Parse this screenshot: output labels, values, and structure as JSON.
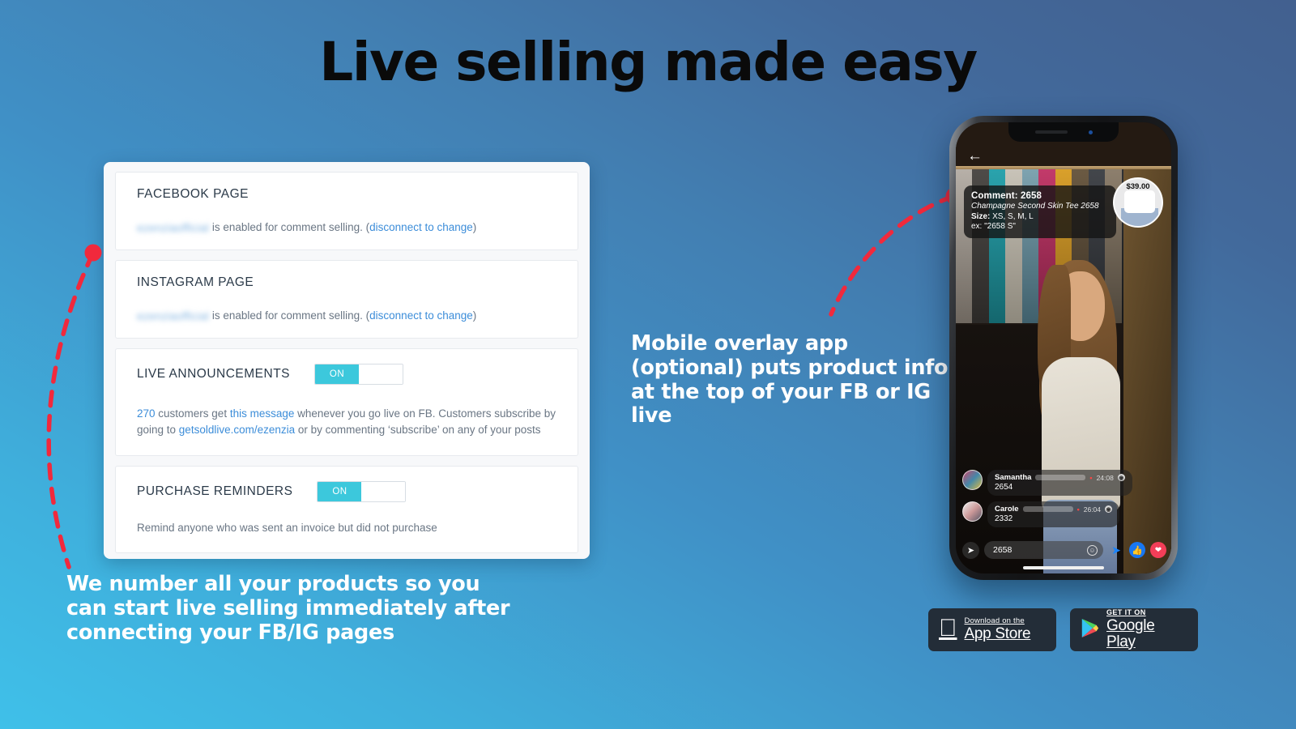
{
  "headline": "Live selling made easy",
  "settings_card": {
    "panels": [
      {
        "title": "FACEBOOK PAGE",
        "redacted_account": "ezenziaofficial",
        "desc_before": " is enabled for comment selling. (",
        "link": "disconnect to change",
        "desc_after": ")"
      },
      {
        "title": "INSTAGRAM PAGE",
        "redacted_account": "ezenziaofficial",
        "desc_before": " is enabled for comment selling. (",
        "link": "disconnect to change",
        "desc_after": ")"
      },
      {
        "title": "LIVE ANNOUNCEMENTS",
        "toggle_label": "ON",
        "toggle_state": "on",
        "count": "270",
        "t1": " customers get ",
        "link1": "this message",
        "t2": " whenever you go live on FB. Customers subscribe by going to ",
        "link2": "getsoldlive.com/ezenzia",
        "t3": " or by commenting ‘subscribe’ on any of your posts"
      },
      {
        "title": "PURCHASE REMINDERS",
        "toggle_label": "ON",
        "toggle_state": "on",
        "desc": "Remind anyone who was sent an invoice but did not purchase"
      }
    ]
  },
  "callouts": {
    "left": "We number all your products so you can start live selling immediately after connecting your FB/IG pages",
    "right": "Mobile overlay app (optional) puts product info at the top of your FB or IG live"
  },
  "phone": {
    "back_arrow": "←",
    "overlay": {
      "comment_label": "Comment: 2658",
      "product_name": "Champagne Second Skin Tee 2658",
      "size_label": "Size:",
      "size_values": " XS, S, M, L",
      "example": "ex: \"2658 S\""
    },
    "price_bubble": "$39.00",
    "comments": [
      {
        "name": "Samantha",
        "time": "24:08",
        "text": "2654"
      },
      {
        "name": "Carole",
        "time": "26:04",
        "text": "2332"
      }
    ],
    "comment_bar": {
      "value": "2658",
      "share_icon": "➤",
      "emoji_icon": "☺",
      "send_icon": "➤",
      "like_icon": "👍",
      "heart_icon": "❤"
    }
  },
  "badges": [
    {
      "top": "Download on the",
      "bottom": "App Store",
      "icon": "apple-icon"
    },
    {
      "top": "GET IT ON",
      "bottom": "Google Play",
      "icon": "google-play-icon"
    }
  ],
  "colors": {
    "accent_cyan": "#3CC8DC",
    "link_blue": "#3C8DD9",
    "marker_red": "#F1293C",
    "badge_dark": "#232D38"
  }
}
